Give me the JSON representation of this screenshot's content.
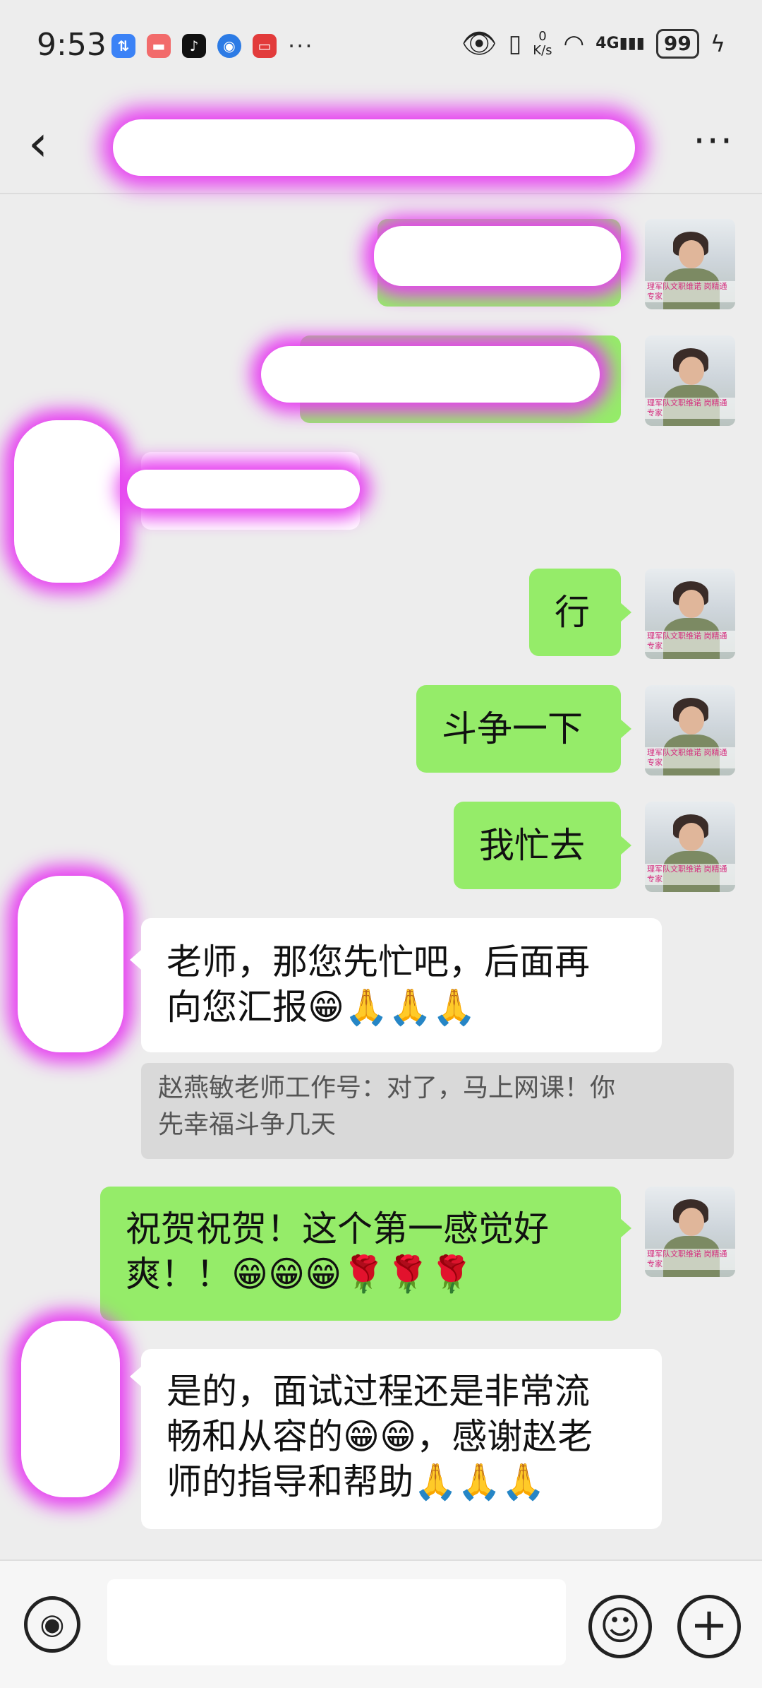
{
  "status_bar": {
    "time": "9:53",
    "net_speed_value": "0",
    "net_speed_unit": "K/s",
    "signal_label": "4G",
    "battery": "99",
    "more": "···"
  },
  "header": {
    "back_glyph": "‹",
    "more_glyph": "···"
  },
  "messages": [
    {
      "side": "right",
      "text": "行"
    },
    {
      "side": "right",
      "text": "斗争一下"
    },
    {
      "side": "right",
      "text": "我忙去"
    },
    {
      "side": "left",
      "line1": "老师，那您先忙吧，后面再",
      "line2": "向您汇报😁🙏🙏🙏"
    },
    {
      "side": "quote",
      "line1": "赵燕敏老师工作号：对了，马上网课！你",
      "line2": "先幸福斗争几天"
    },
    {
      "side": "right",
      "line1": "祝贺祝贺！这个第一感觉好",
      "line2": "爽！！😁😁😁🌹🌹🌹"
    },
    {
      "side": "left",
      "line1": "是的，面试过程还是非常流",
      "line2": "畅和从容的😁😁，感谢赵老",
      "line3": "师的指导和帮助🙏🙏🙏"
    }
  ],
  "avatar": {
    "caption": "理军队文职维诺\n岗精通专家"
  },
  "input_bar": {
    "voice_icon": "voice-icon",
    "emoji_icon": "emoji-icon",
    "plus_icon": "plus-icon"
  },
  "colors": {
    "background": "#ededed",
    "bubble_green": "#95ec69",
    "bubble_white": "#ffffff",
    "redaction": "#e63ff0"
  }
}
